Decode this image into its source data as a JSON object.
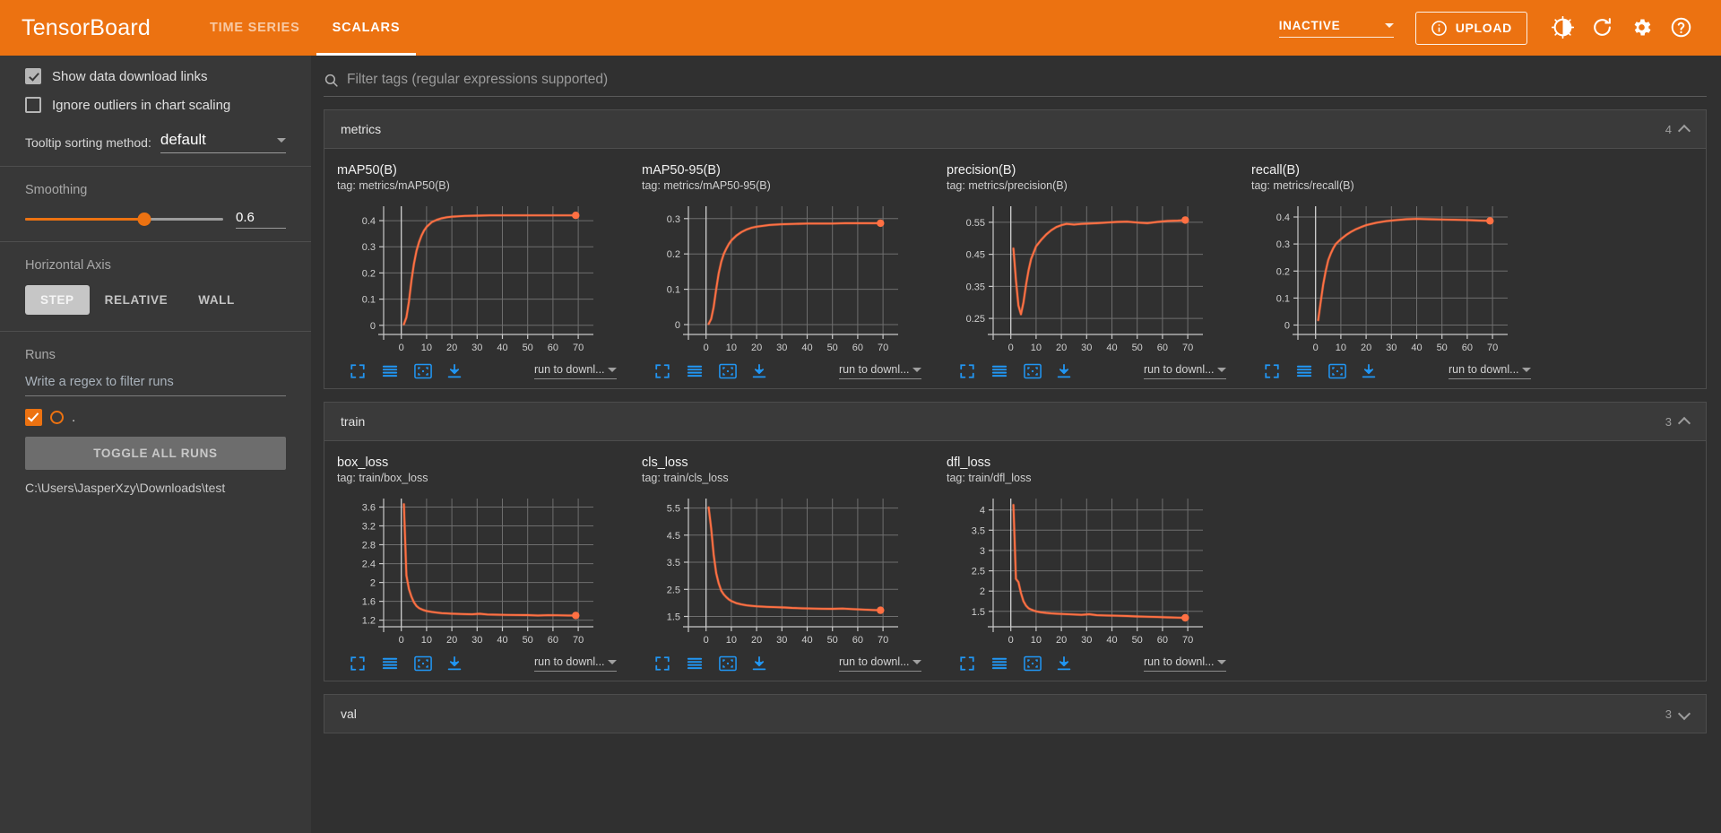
{
  "topbar": {
    "brand": "TensorBoard",
    "tabs": [
      {
        "label": "TIME SERIES",
        "active": false
      },
      {
        "label": "SCALARS",
        "active": true
      }
    ],
    "status_value": "INACTIVE",
    "upload_label": "UPLOAD",
    "icons": [
      "info-icon",
      "brightness-icon",
      "refresh-icon",
      "settings-icon",
      "help-icon"
    ],
    "accent_color": "#ec7211"
  },
  "sidebar": {
    "show_download_links": {
      "label": "Show data download links",
      "checked": true
    },
    "ignore_outliers": {
      "label": "Ignore outliers in chart scaling",
      "checked": false
    },
    "tooltip_sorting": {
      "label": "Tooltip sorting method:",
      "value": "default"
    },
    "smoothing": {
      "label": "Smoothing",
      "value": "0.6",
      "percent": 60
    },
    "horizontal_axis": {
      "label": "Horizontal Axis",
      "options": [
        "STEP",
        "RELATIVE",
        "WALL"
      ],
      "selected": "STEP"
    },
    "runs": {
      "label": "Runs",
      "filter_placeholder": "Write a regex to filter runs",
      "run_name": ".",
      "run_color": "#ec7211",
      "toggle_all_label": "TOGGLE ALL RUNS",
      "path": "C:\\Users\\JasperXzy\\Downloads\\test"
    }
  },
  "filter": {
    "placeholder": "Filter tags (regular expressions supported)",
    "icon": "search-icon"
  },
  "sections": [
    {
      "title": "metrics",
      "count": "4",
      "expanded": true
    },
    {
      "title": "train",
      "count": "3",
      "expanded": true
    },
    {
      "title": "val",
      "count": "3",
      "expanded": false
    }
  ],
  "chart_controls": {
    "icons": [
      "fullscreen-icon",
      "data-table-icon",
      "fit-domain-icon",
      "download-icon"
    ],
    "download_select_label": "run to downl...",
    "icon_color": "#2196f3"
  },
  "chart_data": [
    {
      "type": "line",
      "title": "mAP50(B)",
      "tag": "tag: metrics/mAP50(B)",
      "xlabel": "",
      "ylabel": "",
      "xticks": [
        0,
        10,
        20,
        30,
        40,
        50,
        60,
        70
      ],
      "yticks": [
        0,
        0.1,
        0.2,
        0.3,
        0.4
      ],
      "xlim": [
        -7,
        76
      ],
      "ylim": [
        -0.035,
        0.455
      ],
      "series": [
        {
          "name": ".",
          "x": [
            1,
            2,
            3,
            4,
            5,
            6,
            7,
            8,
            9,
            10,
            12,
            14,
            16,
            18,
            20,
            25,
            30,
            35,
            40,
            45,
            50,
            55,
            60,
            65,
            69
          ],
          "values": [
            0.004,
            0.03,
            0.09,
            0.17,
            0.235,
            0.285,
            0.318,
            0.343,
            0.362,
            0.376,
            0.394,
            0.403,
            0.409,
            0.413,
            0.415,
            0.418,
            0.419,
            0.42,
            0.42,
            0.42,
            0.42,
            0.42,
            0.42,
            0.42,
            0.42
          ]
        }
      ],
      "last_point": {
        "x": 69,
        "y": 0.42
      },
      "grid": true
    },
    {
      "type": "line",
      "title": "mAP50-95(B)",
      "tag": "tag: metrics/mAP50-95(B)",
      "xlabel": "",
      "ylabel": "",
      "xticks": [
        0,
        10,
        20,
        30,
        40,
        50,
        60,
        70
      ],
      "yticks": [
        0,
        0.1,
        0.2,
        0.3
      ],
      "xlim": [
        -7,
        76
      ],
      "ylim": [
        -0.028,
        0.335
      ],
      "series": [
        {
          "name": ".",
          "x": [
            1,
            2,
            3,
            4,
            5,
            6,
            7,
            8,
            9,
            10,
            12,
            14,
            16,
            18,
            20,
            25,
            30,
            35,
            40,
            45,
            50,
            55,
            60,
            65,
            69
          ],
          "values": [
            0.002,
            0.016,
            0.05,
            0.1,
            0.145,
            0.178,
            0.2,
            0.215,
            0.228,
            0.238,
            0.252,
            0.262,
            0.269,
            0.274,
            0.277,
            0.282,
            0.284,
            0.285,
            0.286,
            0.286,
            0.286,
            0.287,
            0.287,
            0.287,
            0.287
          ]
        }
      ],
      "last_point": {
        "x": 69,
        "y": 0.287
      },
      "grid": true
    },
    {
      "type": "line",
      "title": "precision(B)",
      "tag": "tag: metrics/precision(B)",
      "xlabel": "",
      "ylabel": "",
      "xticks": [
        0,
        10,
        20,
        30,
        40,
        50,
        60,
        70
      ],
      "yticks": [
        0.25,
        0.35,
        0.45,
        0.55
      ],
      "xlim": [
        -7,
        76
      ],
      "ylim": [
        0.2,
        0.6
      ],
      "series": [
        {
          "name": ".",
          "x": [
            1,
            2,
            3,
            4,
            5,
            6,
            7,
            8,
            10,
            12,
            14,
            16,
            18,
            20,
            22,
            25,
            28,
            31,
            34,
            38,
            42,
            46,
            50,
            54,
            58,
            62,
            66,
            69
          ],
          "values": [
            0.468,
            0.37,
            0.29,
            0.263,
            0.3,
            0.355,
            0.4,
            0.435,
            0.475,
            0.495,
            0.512,
            0.525,
            0.535,
            0.541,
            0.545,
            0.543,
            0.545,
            0.546,
            0.547,
            0.549,
            0.551,
            0.552,
            0.549,
            0.547,
            0.551,
            0.554,
            0.555,
            0.557
          ]
        }
      ],
      "last_point": {
        "x": 69,
        "y": 0.557
      },
      "grid": true
    },
    {
      "type": "line",
      "title": "recall(B)",
      "tag": "tag: metrics/recall(B)",
      "xlabel": "",
      "ylabel": "",
      "xticks": [
        0,
        10,
        20,
        30,
        40,
        50,
        60,
        70
      ],
      "yticks": [
        0,
        0.1,
        0.2,
        0.3,
        0.4
      ],
      "xlim": [
        -7,
        76
      ],
      "ylim": [
        -0.035,
        0.44
      ],
      "series": [
        {
          "name": ".",
          "x": [
            1,
            2,
            3,
            4,
            5,
            6,
            7,
            8,
            10,
            12,
            14,
            16,
            18,
            20,
            24,
            28,
            32,
            36,
            40,
            45,
            50,
            55,
            60,
            65,
            69
          ],
          "values": [
            0.018,
            0.085,
            0.15,
            0.2,
            0.24,
            0.265,
            0.285,
            0.3,
            0.318,
            0.333,
            0.345,
            0.355,
            0.363,
            0.37,
            0.379,
            0.385,
            0.389,
            0.392,
            0.393,
            0.392,
            0.391,
            0.39,
            0.389,
            0.387,
            0.386
          ]
        }
      ],
      "last_point": {
        "x": 69,
        "y": 0.386
      },
      "grid": true
    },
    {
      "type": "line",
      "title": "box_loss",
      "tag": "tag: train/box_loss",
      "xlabel": "",
      "ylabel": "",
      "xticks": [
        0,
        10,
        20,
        30,
        40,
        50,
        60,
        70
      ],
      "yticks": [
        1.2,
        1.6,
        2,
        2.4,
        2.8,
        3.2,
        3.6
      ],
      "xlim": [
        -7,
        76
      ],
      "ylim": [
        1.06,
        3.78
      ],
      "series": [
        {
          "name": ".",
          "x": [
            1,
            2,
            3,
            4,
            5,
            6,
            7,
            8,
            9,
            10,
            12,
            14,
            16,
            18,
            20,
            24,
            28,
            31,
            34,
            38,
            42,
            46,
            50,
            54,
            58,
            62,
            66,
            69
          ],
          "values": [
            3.66,
            2.15,
            1.86,
            1.7,
            1.58,
            1.5,
            1.455,
            1.43,
            1.41,
            1.395,
            1.375,
            1.36,
            1.35,
            1.343,
            1.337,
            1.33,
            1.325,
            1.335,
            1.32,
            1.315,
            1.312,
            1.31,
            1.307,
            1.3,
            1.305,
            1.303,
            1.3,
            1.3
          ]
        }
      ],
      "last_point": {
        "x": 69,
        "y": 1.3
      },
      "grid": true
    },
    {
      "type": "line",
      "title": "cls_loss",
      "tag": "tag: train/cls_loss",
      "xlabel": "",
      "ylabel": "",
      "xticks": [
        0,
        10,
        20,
        30,
        40,
        50,
        60,
        70
      ],
      "yticks": [
        1.5,
        2.5,
        3.5,
        4.5,
        5.5
      ],
      "xlim": [
        -7,
        76
      ],
      "ylim": [
        1.12,
        5.85
      ],
      "series": [
        {
          "name": ".",
          "x": [
            1,
            2,
            3,
            4,
            5,
            6,
            7,
            8,
            9,
            10,
            12,
            14,
            16,
            18,
            20,
            24,
            28,
            31,
            34,
            38,
            42,
            46,
            50,
            54,
            58,
            62,
            66,
            69
          ],
          "values": [
            5.52,
            4.75,
            3.78,
            3.1,
            2.72,
            2.45,
            2.31,
            2.21,
            2.13,
            2.07,
            1.99,
            1.945,
            1.91,
            1.89,
            1.875,
            1.855,
            1.84,
            1.83,
            1.815,
            1.8,
            1.79,
            1.785,
            1.78,
            1.79,
            1.77,
            1.755,
            1.74,
            1.73
          ]
        }
      ],
      "last_point": {
        "x": 69,
        "y": 1.73
      },
      "grid": true
    },
    {
      "type": "line",
      "title": "dfl_loss",
      "tag": "tag: train/dfl_loss",
      "xlabel": "",
      "ylabel": "",
      "xticks": [
        0,
        10,
        20,
        30,
        40,
        50,
        60,
        70
      ],
      "yticks": [
        1.5,
        2,
        2.5,
        3,
        3.5,
        4
      ],
      "xlim": [
        -7,
        76
      ],
      "ylim": [
        1.12,
        4.28
      ],
      "series": [
        {
          "name": ".",
          "x": [
            1,
            2,
            3,
            4,
            5,
            6,
            7,
            8,
            9,
            10,
            12,
            14,
            16,
            18,
            20,
            24,
            28,
            31,
            34,
            38,
            42,
            46,
            50,
            54,
            58,
            62,
            66,
            69
          ],
          "values": [
            4.12,
            2.3,
            2.22,
            1.95,
            1.75,
            1.64,
            1.575,
            1.545,
            1.52,
            1.5,
            1.475,
            1.46,
            1.45,
            1.443,
            1.437,
            1.425,
            1.415,
            1.43,
            1.405,
            1.398,
            1.392,
            1.385,
            1.375,
            1.368,
            1.36,
            1.352,
            1.345,
            1.34
          ]
        }
      ],
      "last_point": {
        "x": 69,
        "y": 1.34
      },
      "grid": true
    }
  ]
}
